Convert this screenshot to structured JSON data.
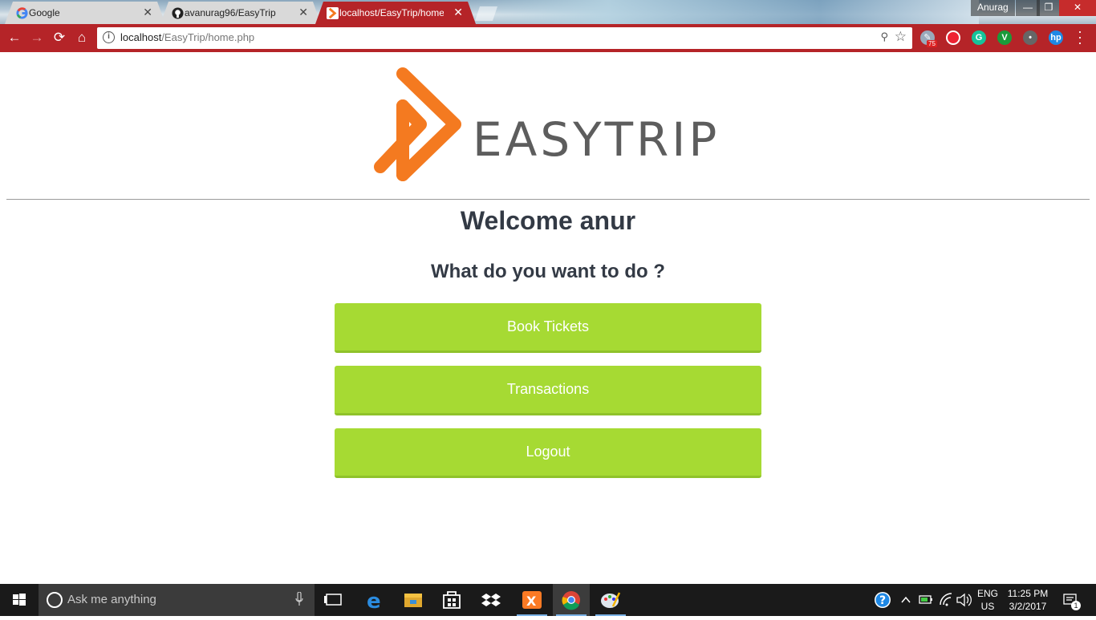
{
  "browser": {
    "tabs": [
      {
        "title": "Google",
        "favicon": "google-icon",
        "active": false
      },
      {
        "title": "avanurag96/EasyTrip",
        "favicon": "github-icon",
        "active": false
      },
      {
        "title": "localhost/EasyTrip/home",
        "favicon": "easytrip-icon",
        "active": true
      }
    ],
    "profile_name": "Anurag",
    "window_controls": {
      "minimize": "—",
      "maximize": "❐",
      "close": "✕"
    },
    "address_bar": {
      "host": "localhost",
      "path": "/EasyTrip/home.php"
    },
    "extension_badge": "75",
    "colors": {
      "toolbar": "#b52428"
    }
  },
  "page": {
    "logo_text": "EASYTRIP",
    "welcome": "Welcome anur",
    "question": "What do you want to do ?",
    "buttons": [
      {
        "label": "Book Tickets"
      },
      {
        "label": "Transactions"
      },
      {
        "label": "Logout"
      }
    ],
    "colors": {
      "accent": "#a6da33",
      "logo_orange": "#f47a20",
      "heading": "#333a45"
    }
  },
  "taskbar": {
    "search_placeholder": "Ask me anything",
    "language": {
      "line1": "ENG",
      "line2": "US"
    },
    "time": "11:25 PM",
    "date": "3/2/2017",
    "notification_count": "1"
  }
}
